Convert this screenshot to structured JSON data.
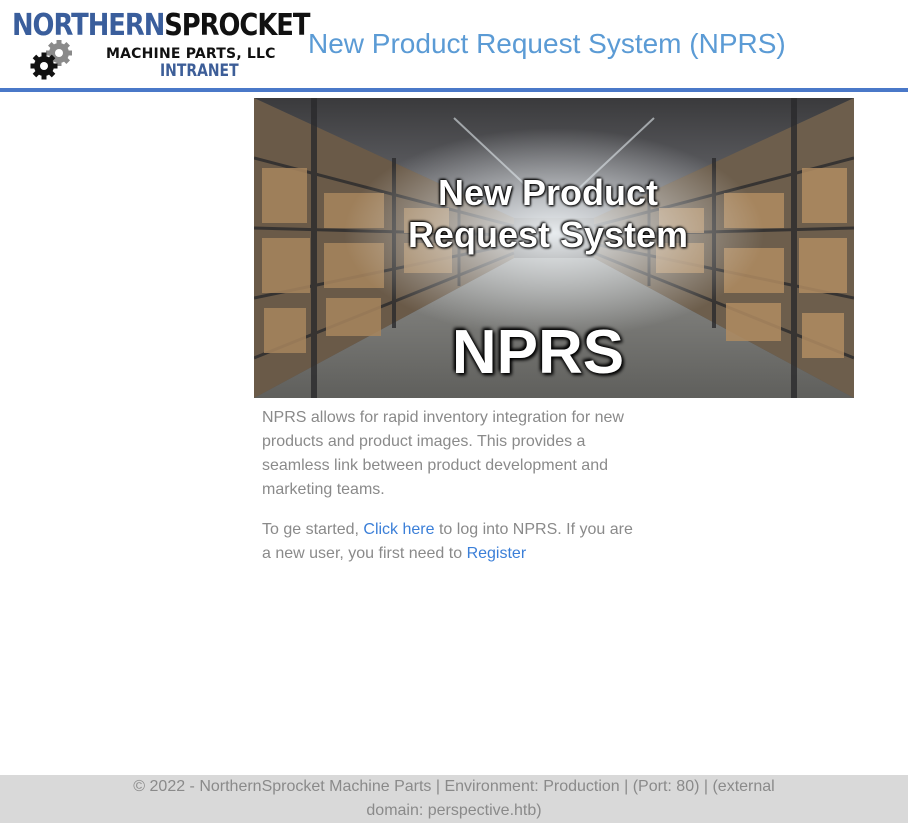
{
  "header": {
    "logo": {
      "line1_part1": "NORTHERN",
      "line1_part2": "SPROCKET",
      "line2": "MACHINE PARTS, LLC",
      "line3": "INTRANET"
    },
    "title": "New Product Request System (NPRS)"
  },
  "banner": {
    "title_line1": "New Product",
    "title_line2": "Request System",
    "abbreviation": "NPRS"
  },
  "content": {
    "intro": "NPRS allows for rapid inventory integration for new products and product images. This provides a seamless link between product development and marketing teams.",
    "getting_started_prefix": "To ge started, ",
    "login_link": "Click here",
    "getting_started_middle": " to log into NPRS. If you are a new user, you first need to ",
    "register_link": "Register"
  },
  "footer": {
    "text": "© 2022 - NorthernSprocket Machine Parts | Environment: Production | (Port: 80) | (external domain: perspective.htb)"
  },
  "colors": {
    "accent": "#4a78c8",
    "title": "#5b9bd5",
    "link": "#3b7fd8",
    "footer_bg": "#d9d9d9"
  }
}
